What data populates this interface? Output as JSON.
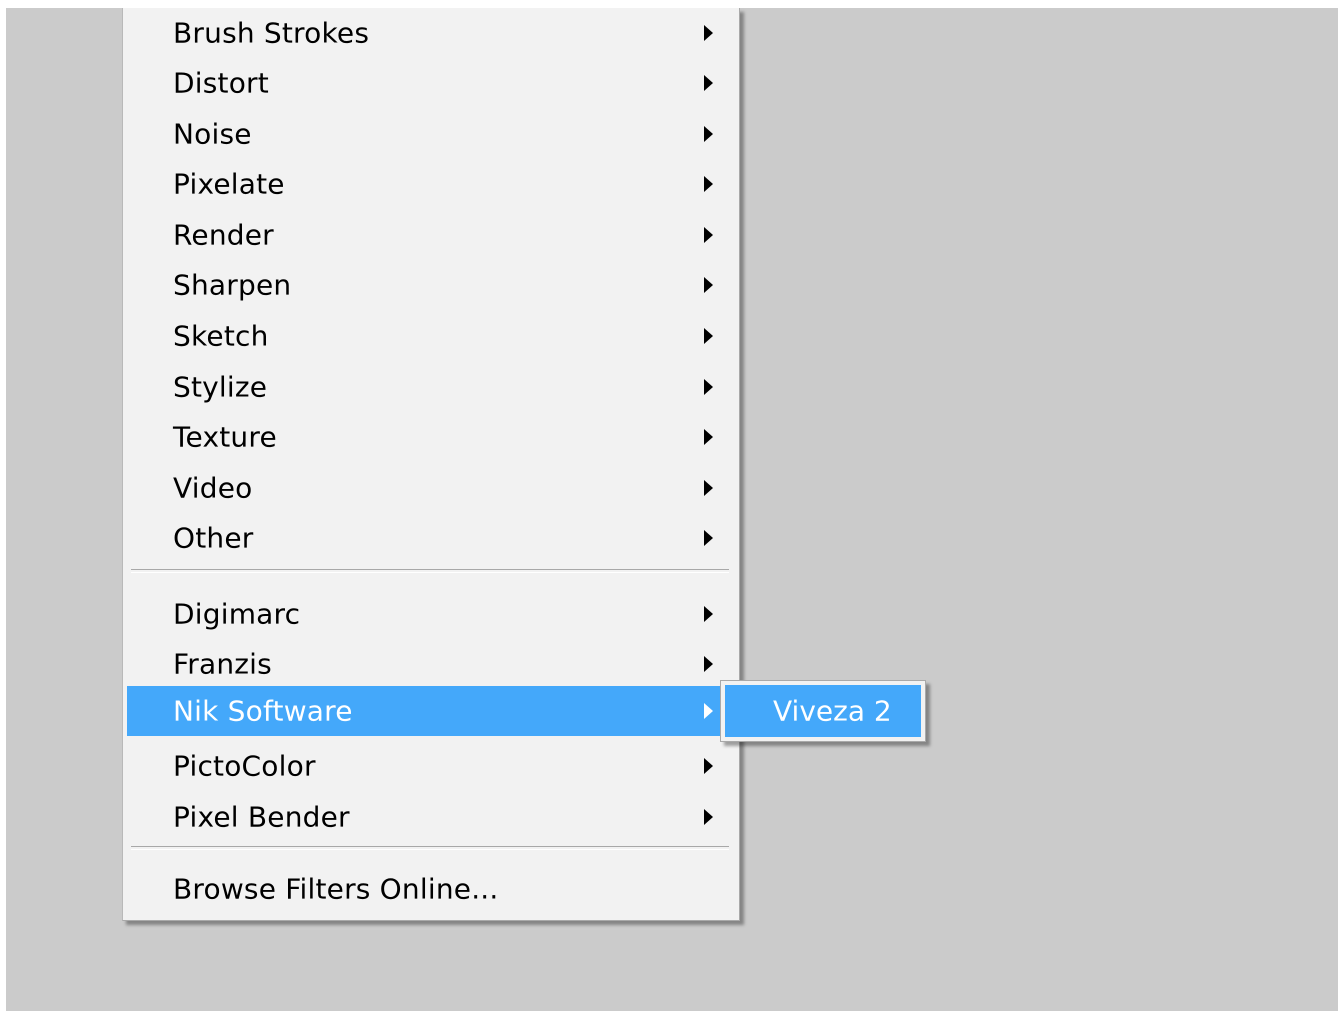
{
  "menu": {
    "group1": [
      {
        "label": "Brush Strokes",
        "has_submenu": true
      },
      {
        "label": "Distort",
        "has_submenu": true
      },
      {
        "label": "Noise",
        "has_submenu": true
      },
      {
        "label": "Pixelate",
        "has_submenu": true
      },
      {
        "label": "Render",
        "has_submenu": true
      },
      {
        "label": "Sharpen",
        "has_submenu": true
      },
      {
        "label": "Sketch",
        "has_submenu": true
      },
      {
        "label": "Stylize",
        "has_submenu": true
      },
      {
        "label": "Texture",
        "has_submenu": true
      },
      {
        "label": "Video",
        "has_submenu": true
      },
      {
        "label": "Other",
        "has_submenu": true
      }
    ],
    "group2": [
      {
        "label": "Digimarc",
        "has_submenu": true
      },
      {
        "label": "Franzis",
        "has_submenu": true
      },
      {
        "label": "Nik Software",
        "has_submenu": true,
        "selected": true
      },
      {
        "label": "PictoColor",
        "has_submenu": true
      },
      {
        "label": "Pixel Bender",
        "has_submenu": true
      }
    ],
    "group3": [
      {
        "label": "Browse Filters Online...",
        "has_submenu": false
      }
    ]
  },
  "submenu": {
    "items": [
      {
        "label": "Viveza 2",
        "selected": true
      }
    ]
  },
  "icons": {
    "submenu_arrow": "submenu-arrow-icon"
  },
  "colors": {
    "selection": "#44a8fa",
    "menu_bg": "#f2f2f2",
    "canvas_bg": "#cbcbcb"
  }
}
